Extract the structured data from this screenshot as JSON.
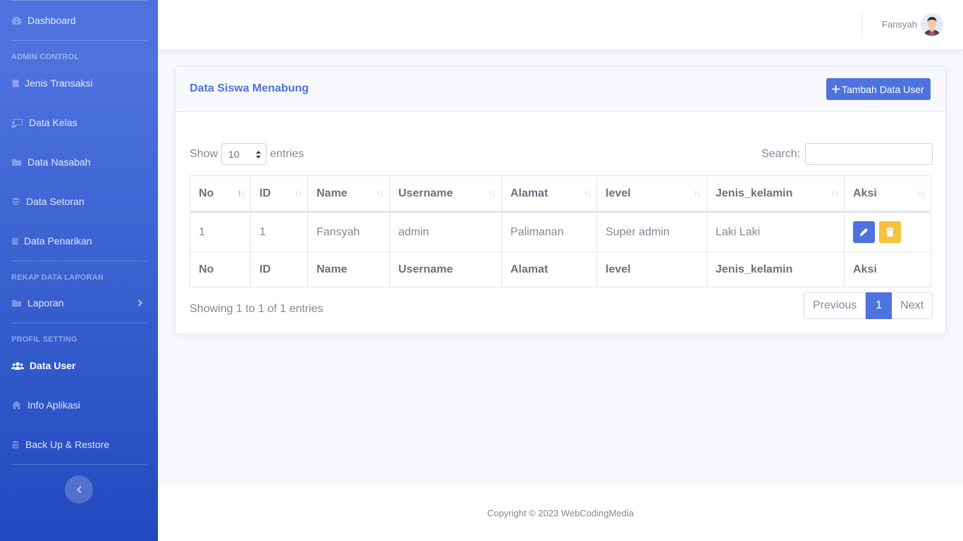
{
  "sidebar": {
    "dashboard": "Dashboard",
    "heading_admin": "ADMIN CONTROL",
    "jenis_transaksi": "Jenis Transaksi",
    "data_kelas": "Data Kelas",
    "data_nasabah": "Data Nasabah",
    "data_setoran": "Data Setoran",
    "data_penarikan": "Data Penarikan",
    "heading_rekap": "REKAP DATA LAPORAN",
    "laporan": "Laporan",
    "heading_profil": "PROFIL SETTING",
    "data_user": "Data User",
    "info_aplikasi": "Info Aplikasi",
    "backup": "Back Up & Restore"
  },
  "topbar": {
    "username": "Fansyah"
  },
  "card": {
    "title": "Data Siswa Menabung",
    "add_button": "Tambah Data User",
    "show_label": "Show",
    "entries_value": "10",
    "entries_label": "entries",
    "search_label": "Search:",
    "search_value": ""
  },
  "table": {
    "columns": [
      "No",
      "ID",
      "Name",
      "Username",
      "Alamat",
      "level",
      "Jenis_kelamin",
      "Aksi"
    ],
    "rows": [
      [
        "1",
        "1",
        "Fansyah",
        "admin",
        "Palimanan",
        "Super admin",
        "Laki Laki"
      ]
    ]
  },
  "pagination": {
    "info": "Showing 1 to 1 of 1 entries",
    "previous": "Previous",
    "current": "1",
    "next": "Next"
  },
  "footer": {
    "copyright": "Copyright © 2023 WebCodingMedia"
  },
  "colors": {
    "primary": "#4e73df",
    "warning": "#f6c23e",
    "sidebar_end": "#224abe"
  },
  "icons": [
    "dashboard-icon",
    "book-icon",
    "chalkboard-icon",
    "folder-icon",
    "coins-icon",
    "file-icon",
    "users-icon",
    "home-icon",
    "database-icon",
    "chevron-right-icon",
    "chevron-left-icon",
    "plus-icon",
    "pencil-icon",
    "trash-icon"
  ]
}
